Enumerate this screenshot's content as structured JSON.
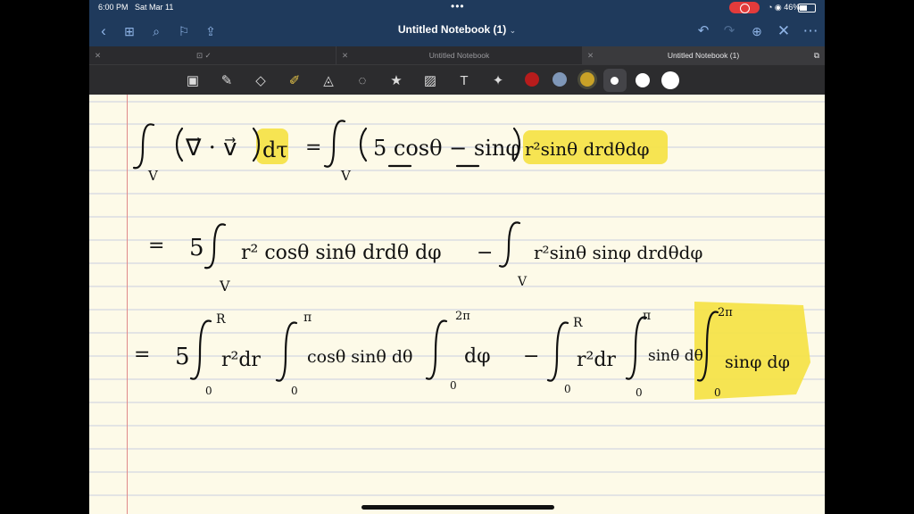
{
  "status": {
    "time": "6:00 PM",
    "date": "Sat Mar 11",
    "battery": "46%",
    "rec_icon": "screen-record-icon"
  },
  "nav": {
    "title": "Untitled Notebook (1)",
    "title_chevron": "⌄"
  },
  "tabs": [
    {
      "label": "",
      "active": false
    },
    {
      "label": "Untitled Notebook",
      "active": false
    },
    {
      "label": "Untitled Notebook (1)",
      "active": true
    }
  ],
  "toolbar": {
    "tools": [
      "lasso-image-icon",
      "pen-icon",
      "eraser-icon",
      "highlighter-icon",
      "shapes-icon",
      "lasso-icon",
      "sticker-icon",
      "image-icon",
      "text-icon",
      "laser-pointer-icon"
    ],
    "colors": [
      "#b71c1c",
      "#7f97b8",
      "#c9a227",
      "#ffffff",
      "#ffffff",
      "#ffffff"
    ]
  },
  "handwriting": {
    "line1": "∫_V (∇⃗ · v⃗) dτ = ∫_V (5 cosθ − sinφ) r²sinθ dr dθ dφ",
    "line2": "= 5 ∫_V r² cosθ sinθ dr dθ dφ − ∫_V r² sinθ sinφ dr dθ dφ",
    "line3": "= 5 ∫₀^R r² dr ∫₀^π cosθ sinθ dθ ∫₀^2π dφ − ∫₀^R r² dr ∫₀^π sinθ dθ ∫₀^2π sinφ dφ",
    "highlight_color": "#f6e34a"
  }
}
